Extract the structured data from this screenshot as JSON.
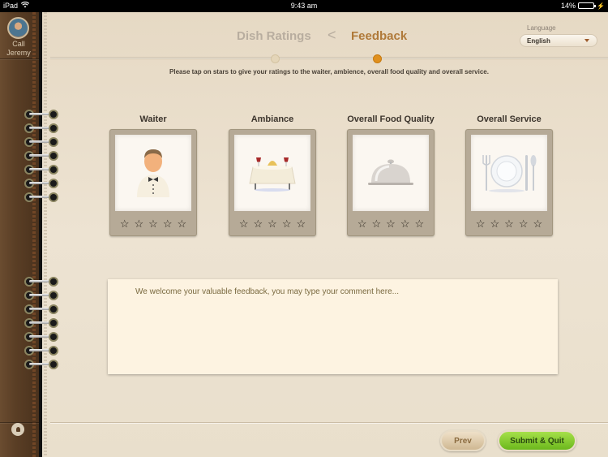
{
  "status_bar": {
    "device": "iPad",
    "time": "9:43 am",
    "battery_percent": "14%",
    "battery_level": 0.14
  },
  "sidebar": {
    "contact_action": "Call",
    "contact_name": "Jeremy"
  },
  "header": {
    "previous_step": "Dish Ratings",
    "back_chevron": "<",
    "current_step": "Feedback"
  },
  "language": {
    "label": "Language",
    "selected": "English"
  },
  "progress": {
    "steps_total": 2,
    "current_step": 2,
    "active_color": "#e0901e",
    "inactive_color": "#e4d5b8"
  },
  "instructions": "Please tap on stars to give your ratings to the waiter, ambience, overall food quality and overall service.",
  "rating_cards": [
    {
      "title": "Waiter",
      "icon": "waiter-icon",
      "rating": 0,
      "max": 5
    },
    {
      "title": "Ambiance",
      "icon": "dining-table-icon",
      "rating": 0,
      "max": 5
    },
    {
      "title": "Overall Food Quality",
      "icon": "cloche-icon",
      "rating": 0,
      "max": 5
    },
    {
      "title": "Overall Service",
      "icon": "plate-cutlery-icon",
      "rating": 0,
      "max": 5
    }
  ],
  "star_glyph": "☆",
  "comment": {
    "placeholder": "We welcome your valuable feedback, you may type your comment here...",
    "value": ""
  },
  "buttons": {
    "prev": "Prev",
    "submit": "Submit & Quit"
  }
}
